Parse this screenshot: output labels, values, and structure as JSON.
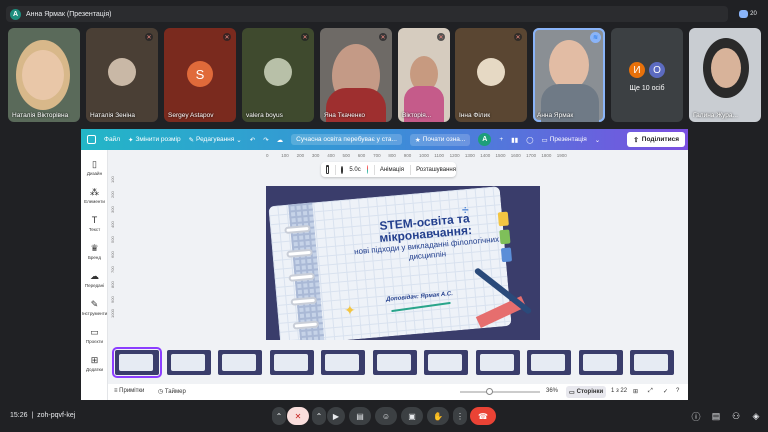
{
  "meet": {
    "presenter_initial": "А",
    "presentation_title": "Анна Ярмак (Презентація)",
    "people_count": "20",
    "meeting_time": "15:26",
    "meeting_code": "zoh-pqvf-kej",
    "participants": [
      {
        "name": "Наталія Вікторівна",
        "type": "video",
        "muted": false
      },
      {
        "name": "Наталія Зеніна",
        "type": "photo",
        "muted": true
      },
      {
        "name": "Sergey Astapov",
        "type": "letter",
        "letter": "S",
        "muted": true
      },
      {
        "name": "valera boyus",
        "type": "photo",
        "muted": true
      },
      {
        "name": "Яна Ткаченко",
        "type": "video",
        "muted": true
      },
      {
        "name": "Вікторія...",
        "type": "video",
        "muted": true
      },
      {
        "name": "Інна Філик",
        "type": "photo",
        "muted": true
      },
      {
        "name": "Анна Ярмак",
        "type": "video",
        "speaking": true
      },
      {
        "name": "Ще 10 осіб",
        "type": "more",
        "letters": [
          "И",
          "О"
        ]
      },
      {
        "name": "Галина Жура...",
        "type": "video"
      }
    ]
  },
  "canva": {
    "toolbar": {
      "file": "Файл",
      "resize": "Змінити розмір",
      "editing": "Редагування",
      "doc_title": "Сучасна освіта перебуває у ста...",
      "record": "Почати озна...",
      "user_initial": "A",
      "present": "Презентація",
      "share": "Поділитися"
    },
    "context_toolbar": {
      "duration": "5.0с",
      "animation": "Анімація",
      "arrange": "Розташування"
    },
    "sidebar": [
      {
        "icon": "design-icon",
        "label": "Дизайн"
      },
      {
        "icon": "elements-icon",
        "label": "Елементи"
      },
      {
        "icon": "text-icon",
        "label": "Текст"
      },
      {
        "icon": "brand-icon",
        "label": "Бренд"
      },
      {
        "icon": "upload-icon",
        "label": "Передані"
      },
      {
        "icon": "tools-icon",
        "label": "Інструменти"
      },
      {
        "icon": "projects-icon",
        "label": "Проєкти"
      },
      {
        "icon": "apps-icon",
        "label": "Додатки"
      }
    ],
    "ruler_h": [
      "0",
      "100",
      "200",
      "300",
      "400",
      "500",
      "600",
      "700",
      "800",
      "900",
      "1000",
      "1100",
      "1200",
      "1300",
      "1400",
      "1500",
      "1600",
      "1700",
      "1800",
      "1900"
    ],
    "ruler_v": [
      "100",
      "200",
      "300",
      "400",
      "500",
      "600",
      "700",
      "800",
      "900",
      "1000"
    ],
    "slide": {
      "title_bold": "STEM",
      "title_rest": "-освіта та мікронавчання:",
      "subtitle": "нові підходи у викладанні філологічних дисциплін",
      "author": "Доповідач: Ярмак А.С."
    },
    "thumbnail_count": 11,
    "bottom": {
      "notes": "Примітки",
      "timer": "Таймер",
      "zoom": "36%",
      "zoom_fraction": 0.36,
      "pages": "Сторінки",
      "page_counter": "1 з 22"
    },
    "colors": {
      "accent": "#8b3dff",
      "share_bg": "#ffffff",
      "slide_bg": "#3a3d6b"
    }
  }
}
